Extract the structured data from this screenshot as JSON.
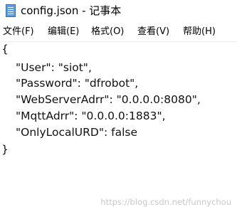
{
  "window": {
    "title": "config.json - 记事本"
  },
  "menu": {
    "items": [
      "文件(F)",
      "编辑(E)",
      "格式(O)",
      "查看(V)",
      "帮助(H)"
    ]
  },
  "editor": {
    "lines": [
      "{",
      "\"User\": \"siot\",",
      "\"Password\": \"dfrobot\",",
      "\"WebServerAdrr\": \"0.0.0.0:8080\",",
      "\"MqttAdrr\": \"0.0.0.0:1883\",",
      "\"OnlyLocalURD\": false",
      "}"
    ]
  },
  "watermark": "https://blog.csdn.net/funnychou",
  "icons": {
    "app": "notepad-icon"
  }
}
